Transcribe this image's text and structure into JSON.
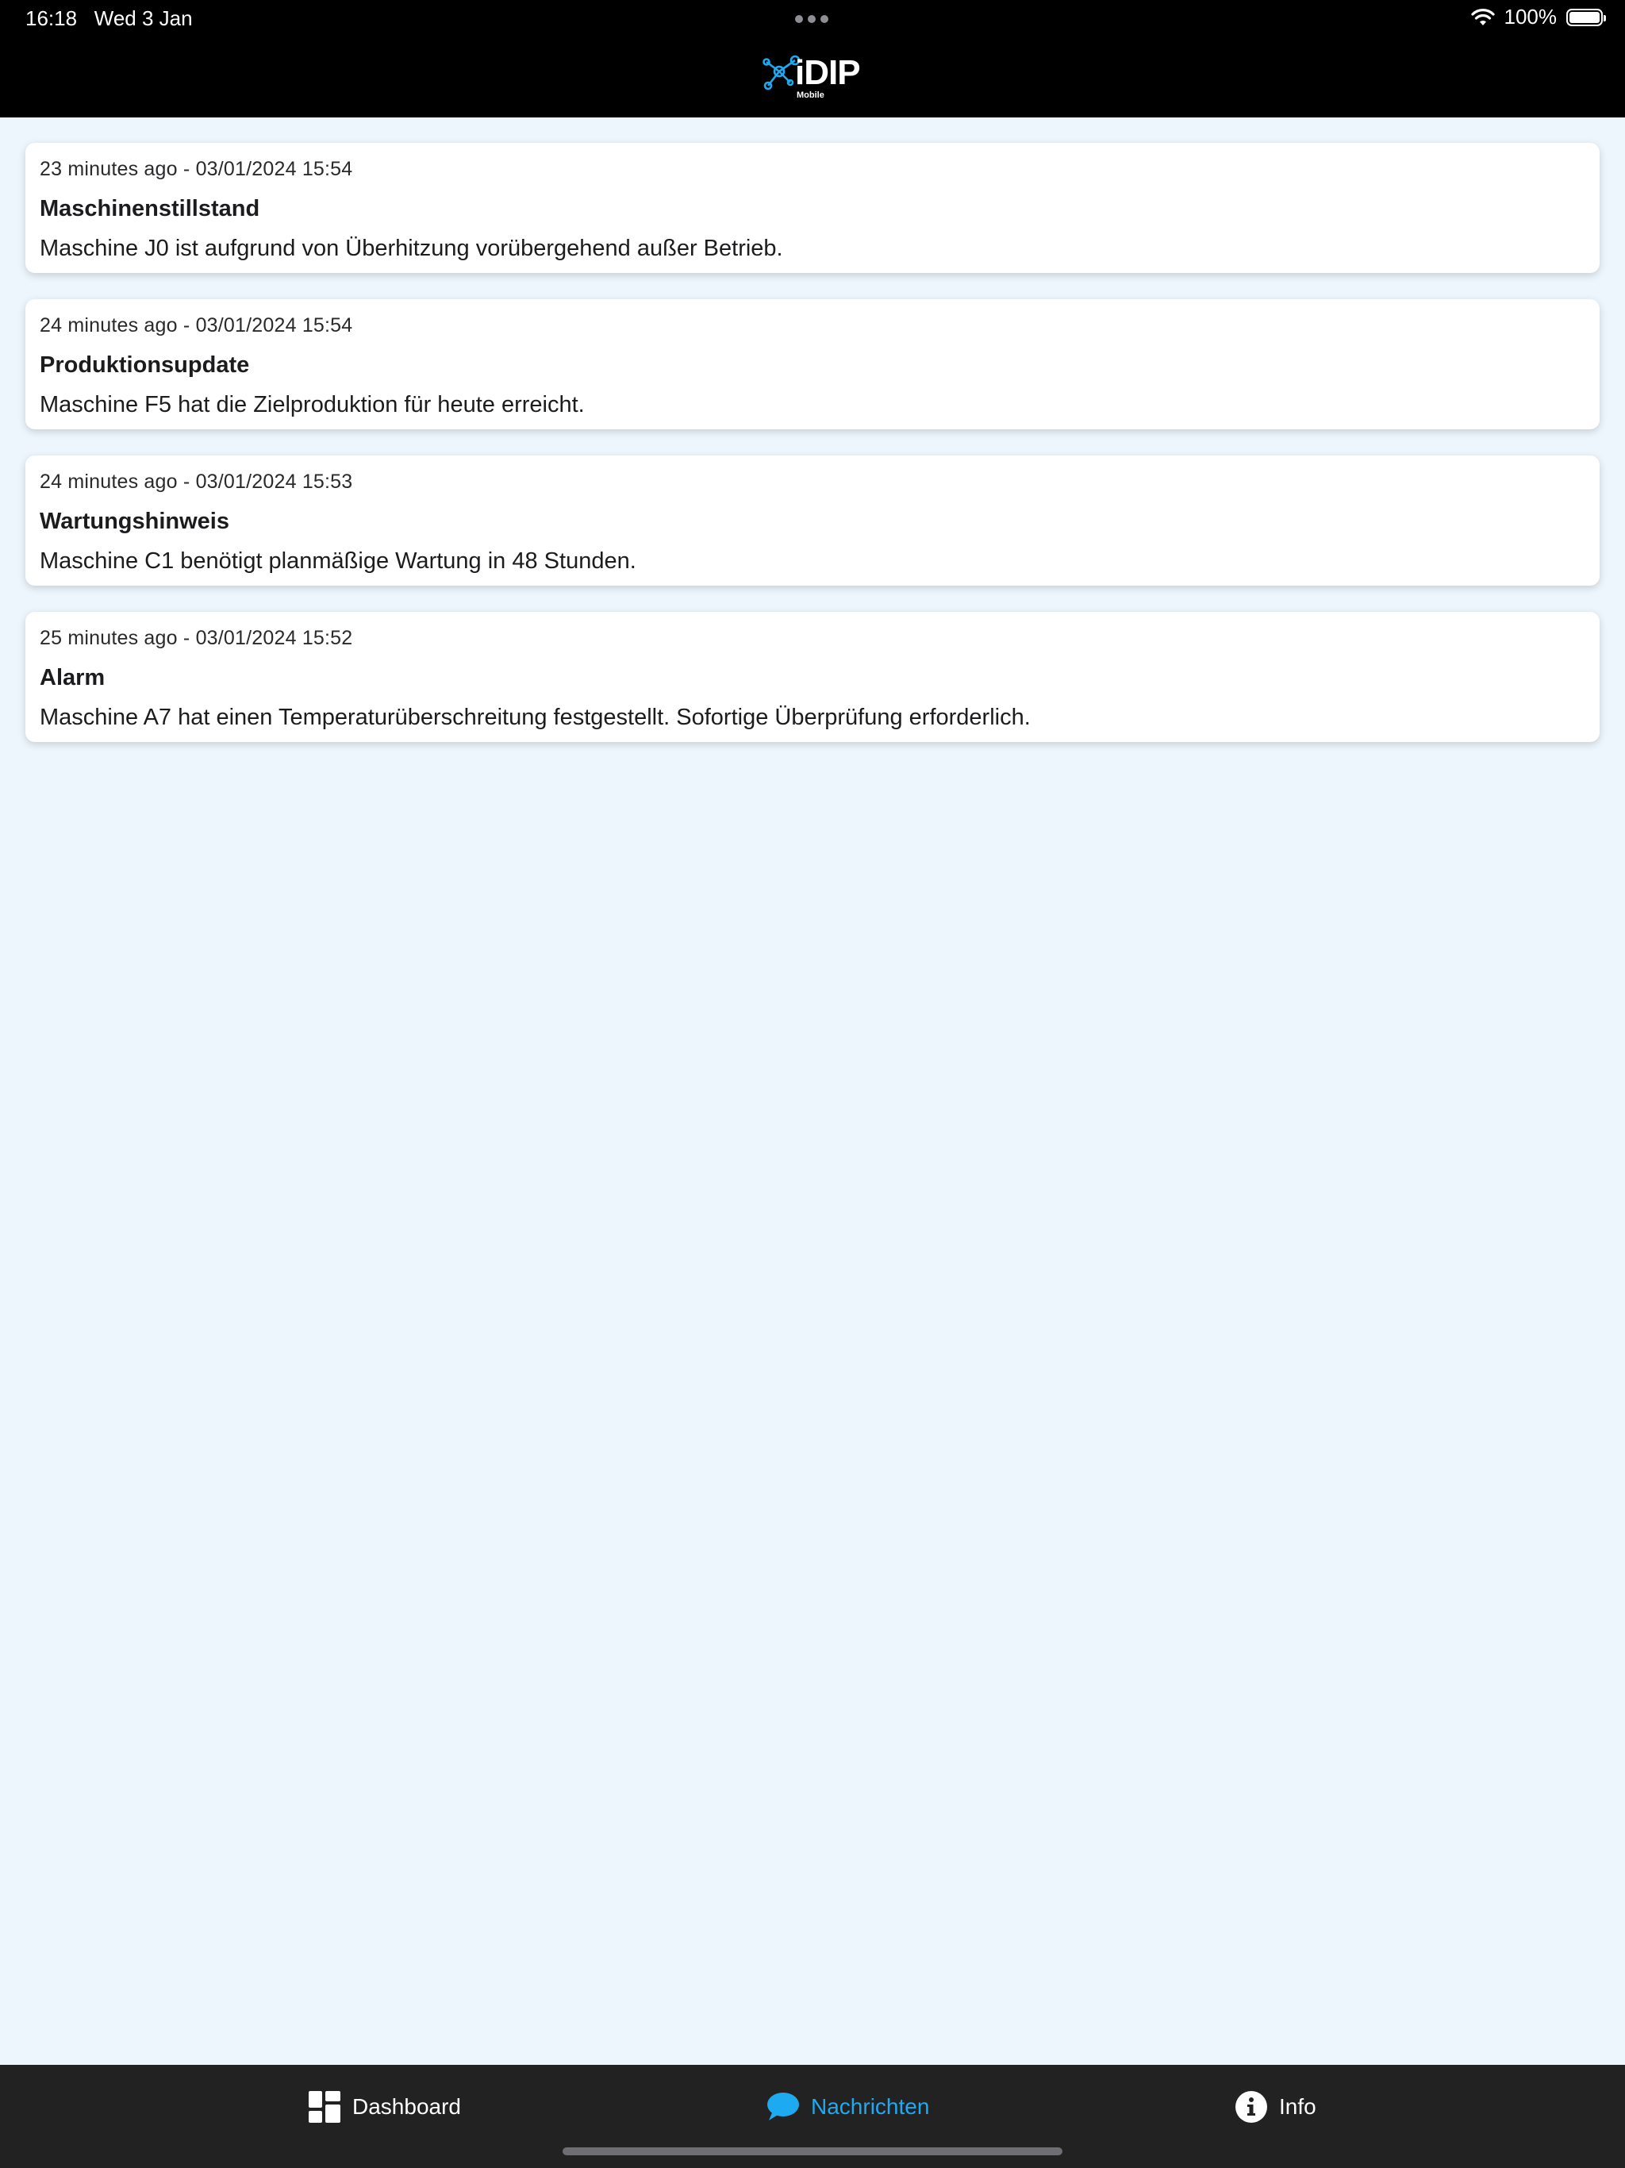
{
  "status_bar": {
    "time": "16:18",
    "date": "Wed 3 Jan",
    "battery": "100%",
    "battery_level": 1.0,
    "icons": [
      "more-dots-icon",
      "wifi-icon",
      "battery-icon"
    ]
  },
  "header": {
    "logo_text": "iDIP",
    "logo_subtext": "Mobile",
    "logo_icon": "network-nodes-icon",
    "accent_color": "#1eaaf1"
  },
  "messages": [
    {
      "time": "23 minutes ago - 03/01/2024 15:54",
      "title": "Maschinenstillstand",
      "body": "Maschine J0 ist aufgrund von Überhitzung vorübergehend außer Betrieb."
    },
    {
      "time": "24 minutes ago - 03/01/2024 15:54",
      "title": "Produktionsupdate",
      "body": "Maschine F5 hat die Zielproduktion für heute erreicht."
    },
    {
      "time": "24 minutes ago - 03/01/2024 15:53",
      "title": "Wartungshinweis",
      "body": "Maschine C1 benötigt planmäßige Wartung in 48 Stunden."
    },
    {
      "time": "25 minutes ago - 03/01/2024 15:52",
      "title": "Alarm",
      "body": "Maschine A7 hat einen Temperaturüberschreitung festgestellt. Sofortige Überprüfung erforderlich."
    }
  ],
  "tabs": [
    {
      "label": "Dashboard",
      "icon": "dashboard-icon",
      "active": false
    },
    {
      "label": "Nachrichten",
      "icon": "chat-bubble-icon",
      "active": true
    },
    {
      "label": "Info",
      "icon": "info-icon",
      "active": false
    }
  ],
  "colors": {
    "page_background": "#edf5fd",
    "header_background": "#000000",
    "tabbar_background": "#222222",
    "active_tab": "#1eaaf1"
  }
}
